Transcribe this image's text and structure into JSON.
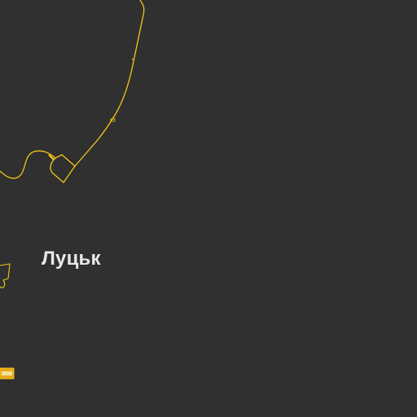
{
  "map": {
    "background_color": "#303030",
    "road_color": "#f5c518",
    "city_label_color": "#e8e8e8",
    "city": {
      "name": "Луцьк"
    },
    "features": [
      "ring-road",
      "road-interchange-north",
      "road-junction-west",
      "road-marker-southwest"
    ]
  }
}
